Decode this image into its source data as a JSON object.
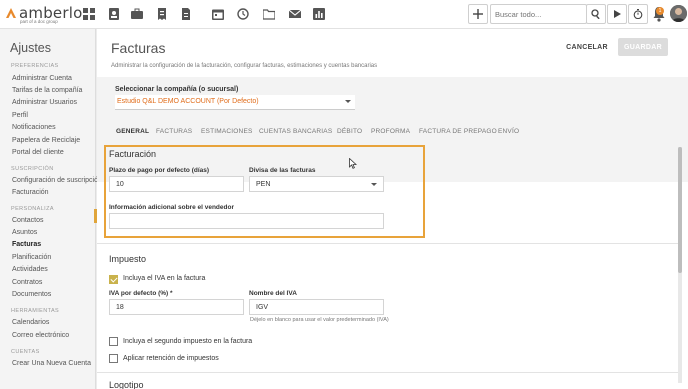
{
  "topbar": {
    "logo_text": "amberlo",
    "logo_sub": "part of a doc group",
    "icons": [
      "dashboard-icon",
      "contacts-icon",
      "briefcase-icon",
      "invoice-icon",
      "document-icon",
      "calendar-icon",
      "history-icon",
      "folder-icon",
      "mail-icon",
      "reports-icon"
    ],
    "search_placeholder": "Buscar todo...",
    "notification_count": "1",
    "accent": "#e88a2d"
  },
  "sidebar": {
    "title": "Ajustes",
    "sections": [
      {
        "label": "PREFERENCIAS",
        "items": [
          "Administrar Cuenta",
          "Tarifas de la compañía",
          "Administrar Usuarios",
          "Perfil",
          "Notificaciones",
          "Papelera de Reciclaje",
          "Portal del cliente"
        ]
      },
      {
        "label": "SUSCRIPCIÓN",
        "items": [
          "Configuración de suscripción",
          "Facturación"
        ]
      },
      {
        "label": "PERSONALIZA",
        "items": [
          "Contactos",
          "Asuntos",
          "Facturas",
          "Planificación",
          "Actividades",
          "Contratos",
          "Documentos"
        ]
      },
      {
        "label": "HERRAMIENTAS",
        "items": [
          "Calendarios",
          "Correo electrónico"
        ]
      },
      {
        "label": "CUENTAS",
        "items": [
          "Crear Una Nueva Cuenta"
        ]
      }
    ],
    "active_item": "Facturas"
  },
  "main": {
    "title": "Facturas",
    "description": "Administrar la configuración de la facturación, configurar facturas, estimaciones y cuentas bancarias",
    "cancel_label": "CANCELAR",
    "save_label": "GUARDAR",
    "company_label": "Seleccionar la compañía (o sucursal)",
    "company_value": "Estudio Q&L DEMO ACCOUNT (Por Defecto)",
    "tabs": [
      "GENERAL",
      "FACTURAS",
      "ESTIMACIONES",
      "CUENTAS BANCARIAS",
      "DÉBITO",
      "PROFORMA",
      "FACTURA DE PREPAGO",
      "ENVÍO"
    ],
    "active_tab": "GENERAL"
  },
  "facturacion": {
    "title": "Facturación",
    "payment_term_label": "Plazo de pago por defecto (días)",
    "payment_term_value": "10",
    "currency_label": "Divisa de las facturas",
    "currency_value": "PEN",
    "seller_info_label": "Información adicional sobre el vendedor",
    "seller_info_value": ""
  },
  "impuesto": {
    "title": "Impuesto",
    "include_vat_label": "Incluya el IVA en la factura",
    "include_vat_checked": true,
    "vat_rate_label": "IVA por defecto (%) *",
    "vat_rate_value": "18",
    "vat_name_label": "Nombre del IVA",
    "vat_name_value": "IGV",
    "vat_name_help": "Déjelo en blanco para usar el valor predeterminado (IVA)",
    "second_tax_label": "Incluya el segundo impuesto en la factura",
    "second_tax_checked": false,
    "withholding_label": "Aplicar retención de impuestos",
    "withholding_checked": false
  },
  "logotipo": {
    "title": "Logotipo"
  }
}
